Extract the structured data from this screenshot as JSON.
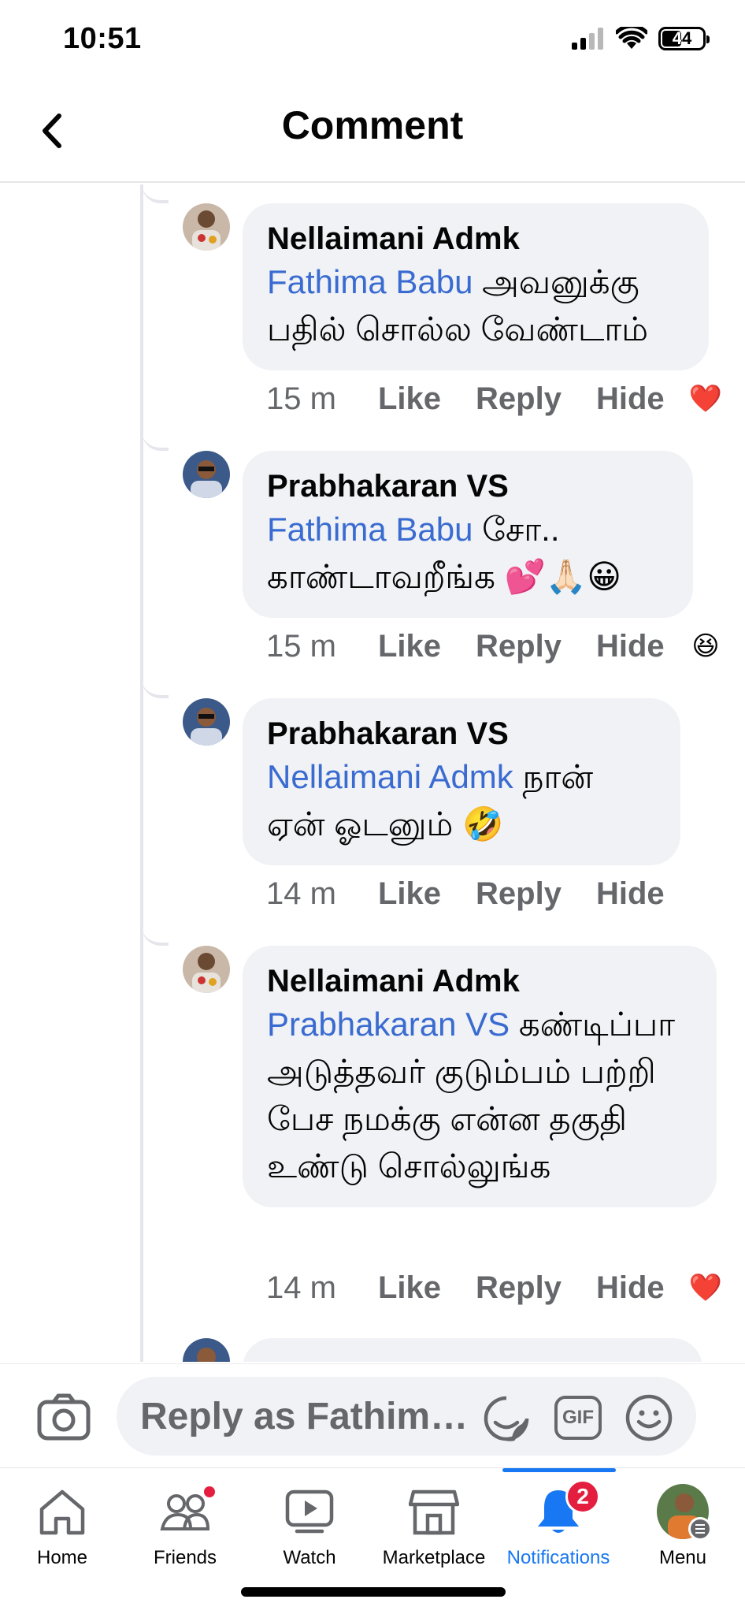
{
  "status_bar": {
    "time": "10:51",
    "battery": "44"
  },
  "header": {
    "title": "Comment"
  },
  "comments": [
    {
      "author": "Nellaimani Admk",
      "mention": "Fathima Babu",
      "text_after_mention": " அவனுக்கு பதில் சொல்ல வேண்டாம்",
      "time": "15 m",
      "like": "Like",
      "reply": "Reply",
      "hide": "Hide",
      "reaction": "❤️"
    },
    {
      "author": "Prabhakaran VS",
      "mention": "Fathima Babu",
      "text_after_mention": " சோ.. காண்டாவறீங்க 💕🙏🏻😀",
      "time": "15 m",
      "like": "Like",
      "reply": "Reply",
      "hide": "Hide",
      "reaction": "😆"
    },
    {
      "author": "Prabhakaran VS",
      "mention": "Nellaimani Admk",
      "text_after_mention": " நான் ஏன் ஓடனும் 🤣",
      "time": "14 m",
      "like": "Like",
      "reply": "Reply",
      "hide": "Hide"
    },
    {
      "author": "Nellaimani Admk",
      "mention": "Prabhakaran VS",
      "text_after_mention": " கண்டிப்பா அடுத்தவர் குடும்பம் பற்றி பேச நமக்கு என்ன தகுதி உண்டு சொல்லுங்க",
      "time": "14 m",
      "like": "Like",
      "reply": "Reply",
      "hide": "Hide",
      "reaction": "❤️"
    }
  ],
  "reply_bar": {
    "placeholder": "Reply as Fathim…",
    "gif_label": "GIF"
  },
  "nav": {
    "home": "Home",
    "friends": "Friends",
    "watch": "Watch",
    "marketplace": "Marketplace",
    "notifications": "Notifications",
    "notifications_count": "2",
    "menu": "Menu"
  },
  "colors": {
    "accent": "#1877f2",
    "mention": "#3a6bd1",
    "bubble": "#f0f2f5",
    "badge": "#e41e3f"
  }
}
